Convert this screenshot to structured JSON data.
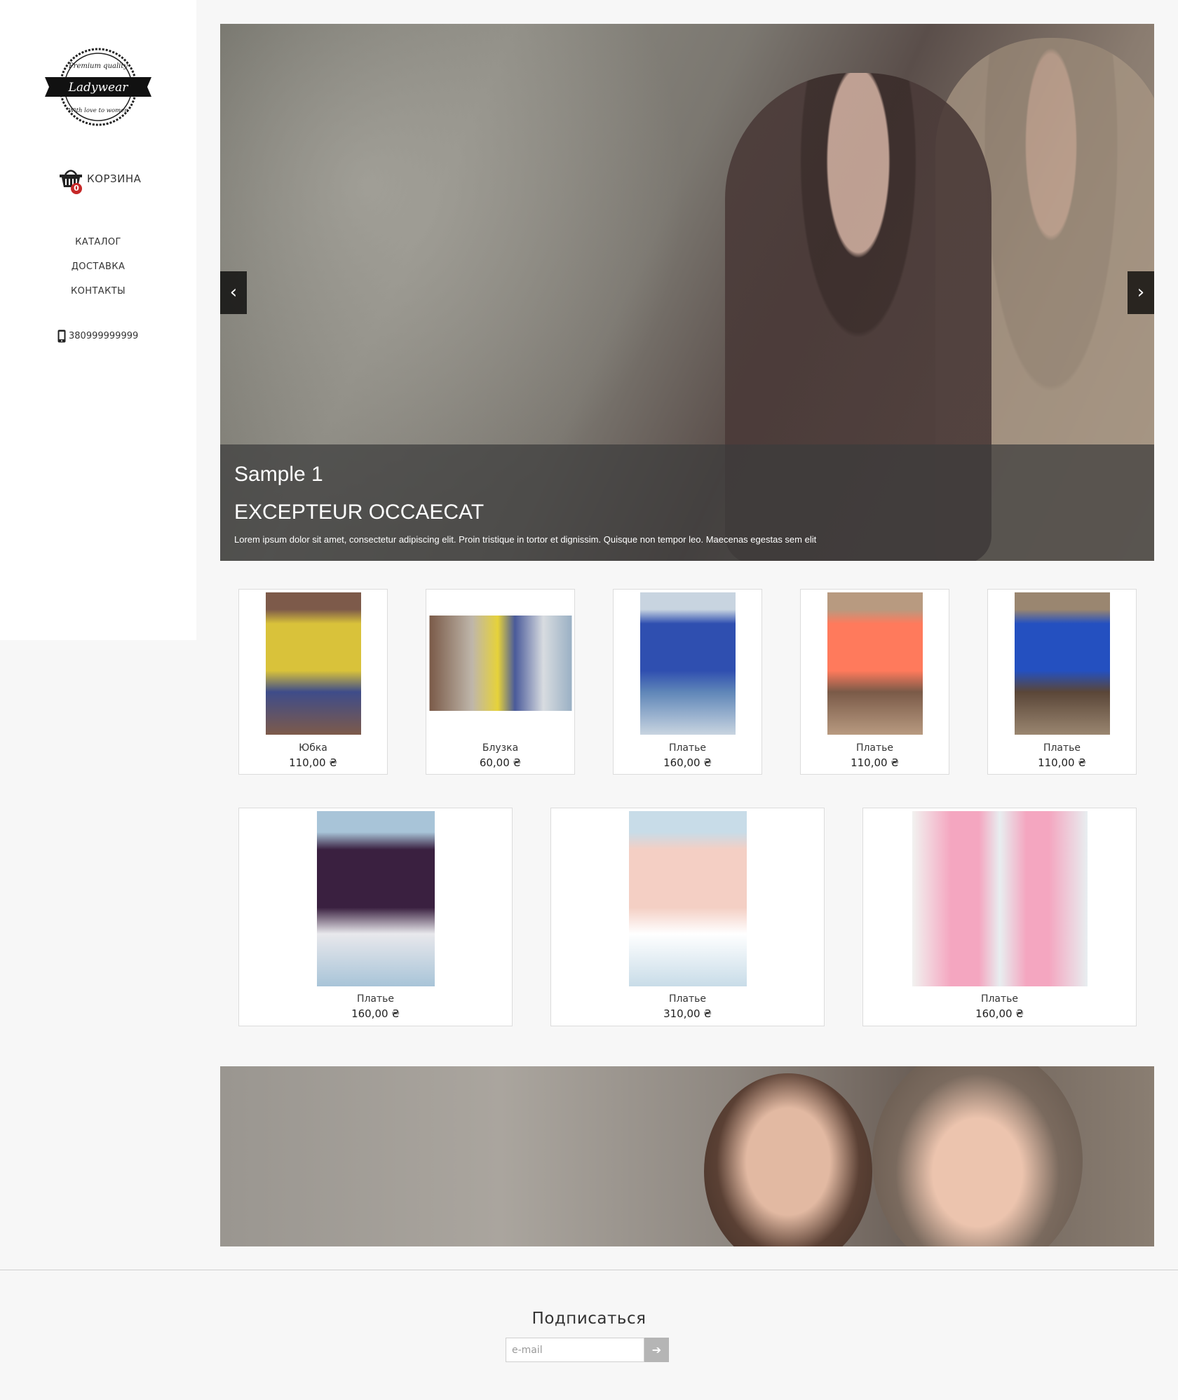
{
  "sidebar": {
    "logo": {
      "top_text": "Premium quality",
      "name": "Ladywear",
      "bottom_text": "With love to women"
    },
    "cart": {
      "label": "КОРЗИНА",
      "count": "0"
    },
    "nav": [
      {
        "label": "КАТАЛОГ"
      },
      {
        "label": "ДОСТАВКА"
      },
      {
        "label": "КОНТАКТЫ"
      }
    ],
    "phone": "380999999999"
  },
  "hero": {
    "caption_sub": "Sample 1",
    "caption_title": "EXCEPTEUR OCCAECAT",
    "caption_text": "Lorem ipsum dolor sit amet, consectetur adipiscing elit. Proin tristique in tortor et dignissim. Quisque non tempor leo. Maecenas egestas sem elit",
    "prev_symbol": "‹",
    "next_symbol": "›"
  },
  "products_row1": [
    {
      "name": "Юбка",
      "price": "110,00 ₴",
      "colors": [
        "#d9c23a",
        "#3e4c8a",
        "#7d5a4a"
      ]
    },
    {
      "name": "Блузка",
      "price": "60,00 ₴",
      "colors": [
        "#e6d23a",
        "#4a5a9a",
        "#9a8a7a"
      ]
    },
    {
      "name": "Платье",
      "price": "160,00 ₴",
      "colors": [
        "#2f4fb0",
        "#5f86b8",
        "#c8d4e0"
      ]
    },
    {
      "name": "Платье",
      "price": "110,00 ₴",
      "colors": [
        "#ff7a5c",
        "#7a5a48",
        "#b89a80"
      ]
    },
    {
      "name": "Платье",
      "price": "110,00 ₴",
      "colors": [
        "#2450c0",
        "#5a4638",
        "#9a8670"
      ]
    }
  ],
  "products_row2": [
    {
      "name": "Платье",
      "price": "160,00 ₴",
      "colors": [
        "#3a2040",
        "#e8e8ec",
        "#a8c4d8"
      ]
    },
    {
      "name": "Платье",
      "price": "310,00 ₴",
      "colors": [
        "#f4cfc4",
        "#ffffff",
        "#c8dce8"
      ]
    },
    {
      "name": "Платье",
      "price": "160,00 ₴",
      "colors": [
        "#f4a6c0",
        "#e8eef0",
        "#28306a"
      ]
    }
  ],
  "subscribe": {
    "title": "Подписаться",
    "email_placeholder": "e-mail",
    "submit_symbol": "➔"
  }
}
